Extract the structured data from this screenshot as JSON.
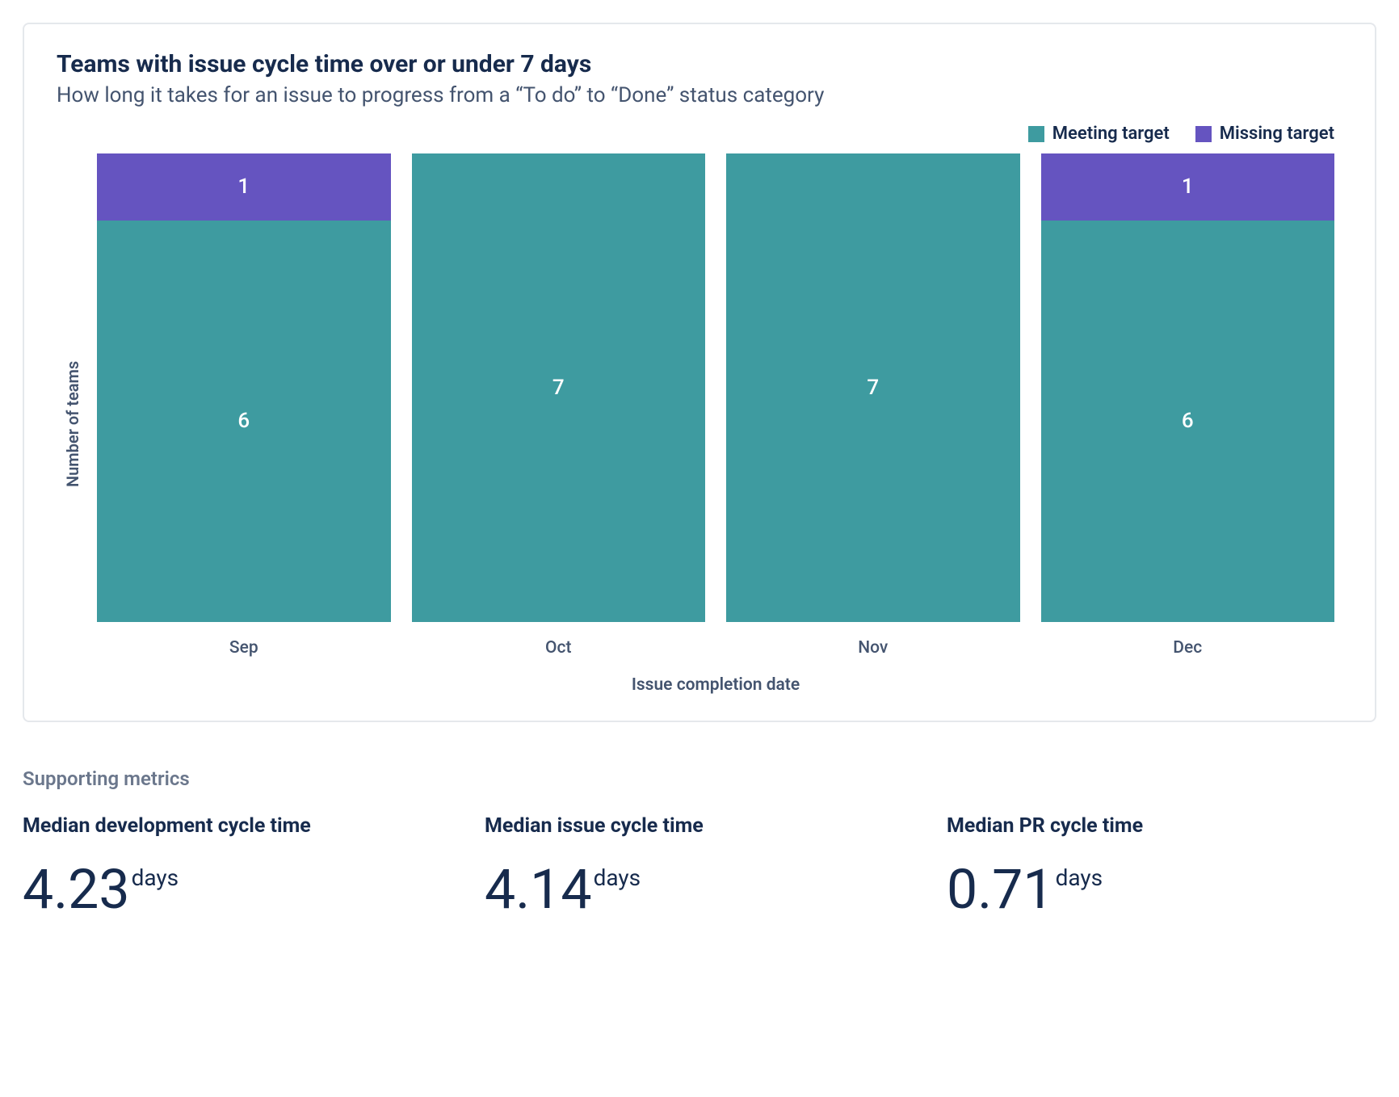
{
  "card": {
    "title": "Teams with issue cycle time over or under 7 days",
    "subtitle": "How long it takes for an issue to progress from a “To do” to “Done” status category"
  },
  "legend": {
    "meeting": "Meeting target",
    "missing": "Missing target"
  },
  "colors": {
    "meeting": "#3E9BA0",
    "missing": "#6554C0"
  },
  "chart_data": {
    "type": "bar",
    "stacked": true,
    "categories": [
      "Sep",
      "Oct",
      "Nov",
      "Dec"
    ],
    "series": [
      {
        "name": "Meeting target",
        "values": [
          6,
          7,
          7,
          6
        ]
      },
      {
        "name": "Missing target",
        "values": [
          1,
          0,
          0,
          1
        ]
      }
    ],
    "xlabel": "Issue completion date",
    "ylabel": "Number of teams",
    "ylim": [
      0,
      7
    ]
  },
  "supporting": {
    "heading": "Supporting metrics",
    "metrics": [
      {
        "label": "Median development cycle time",
        "value": "4.23",
        "unit": "days"
      },
      {
        "label": "Median issue cycle time",
        "value": "4.14",
        "unit": "days"
      },
      {
        "label": "Median PR cycle time",
        "value": "0.71",
        "unit": "days"
      }
    ]
  }
}
